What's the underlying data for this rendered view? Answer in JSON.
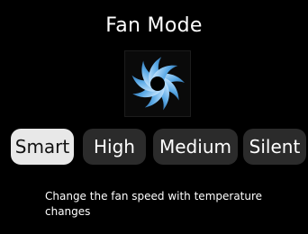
{
  "screen": {
    "title": "Fan Mode",
    "fan_icon": "fan-icon",
    "description": "Change the fan speed with temperature changes"
  },
  "modes": [
    {
      "label": "Smart",
      "selected": true
    },
    {
      "label": "High",
      "selected": false
    },
    {
      "label": "Medium",
      "selected": false
    },
    {
      "label": "Silent",
      "selected": false
    }
  ],
  "colors": {
    "background": "#000000",
    "button": "#2b2b2b",
    "button_selected": "#e8e8e8",
    "fan_blade": "#5aa9e6"
  }
}
